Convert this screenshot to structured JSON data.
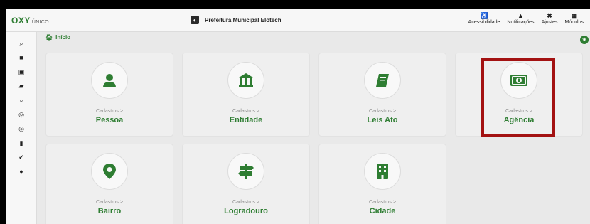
{
  "app": {
    "logo_text": "OXY",
    "logo_sub": "ÚNICO",
    "organization": "Prefeitura Municipal Elotech"
  },
  "topnav": {
    "items": [
      {
        "label": "Acessibilidade",
        "icon": "accessibility-icon"
      },
      {
        "label": "Notificações",
        "icon": "bell-icon"
      },
      {
        "label": "Ajustes",
        "icon": "tools-icon"
      },
      {
        "label": "Módulos",
        "icon": "grid-icon"
      }
    ]
  },
  "breadcrumb": {
    "label": "Início",
    "icon": "home-icon"
  },
  "cards": [
    {
      "section": "Cadastros >",
      "title": "Pessoa",
      "icon": "person-icon"
    },
    {
      "section": "Cadastros >",
      "title": "Entidade",
      "icon": "bank-icon"
    },
    {
      "section": "Cadastros >",
      "title": "Leis Ato",
      "icon": "book-icon"
    },
    {
      "section": "Cadastros >",
      "title": "Agência",
      "icon": "money-bill-icon"
    },
    {
      "section": "Cadastros >",
      "title": "Bairro",
      "icon": "map-pin-icon"
    },
    {
      "section": "Cadastros >",
      "title": "Logradouro",
      "icon": "signpost-icon"
    },
    {
      "section": "Cadastros >",
      "title": "Cidade",
      "icon": "building-icon"
    }
  ],
  "colors": {
    "accent": "#2e7d32",
    "highlight": "#a31212",
    "background": "#e9e9e9"
  }
}
